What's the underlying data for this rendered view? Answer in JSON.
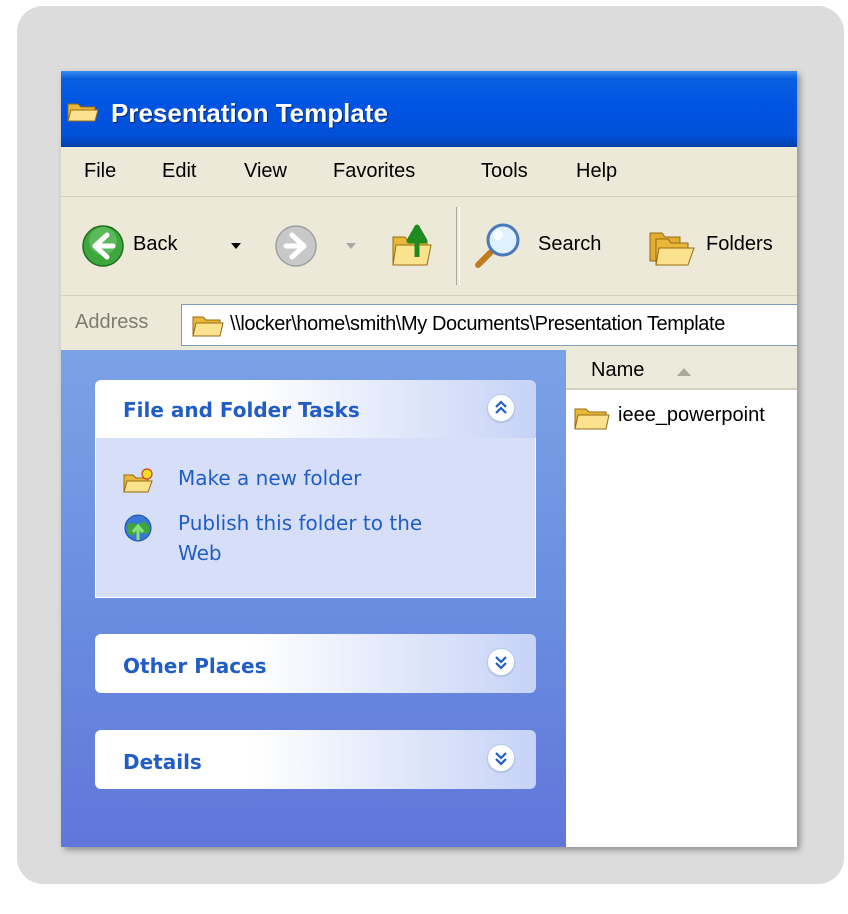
{
  "window": {
    "title": "Presentation Template"
  },
  "menu": [
    "File",
    "Edit",
    "View",
    "Favorites",
    "Tools",
    "Help"
  ],
  "toolbar": {
    "back_label": "Back",
    "search_label": "Search",
    "folders_label": "Folders"
  },
  "address": {
    "label": "Address",
    "value": "\\\\locker\\home\\smith\\My Documents\\Presentation Template"
  },
  "task_pane": {
    "file_folder_tasks": {
      "title": "File and Folder Tasks",
      "items": [
        "Make a new folder",
        "Publish this folder to the",
        "Web"
      ]
    },
    "other_places": {
      "title": "Other Places"
    },
    "details": {
      "title": "Details"
    }
  },
  "file_list": {
    "column_name": "Name",
    "items": [
      "ieee_powerpoint"
    ]
  },
  "colors": {
    "title_bar": "#0054e3",
    "task_pane": "#6a8ee0",
    "link_blue": "#215dc6",
    "chrome": "#ece9d8"
  }
}
